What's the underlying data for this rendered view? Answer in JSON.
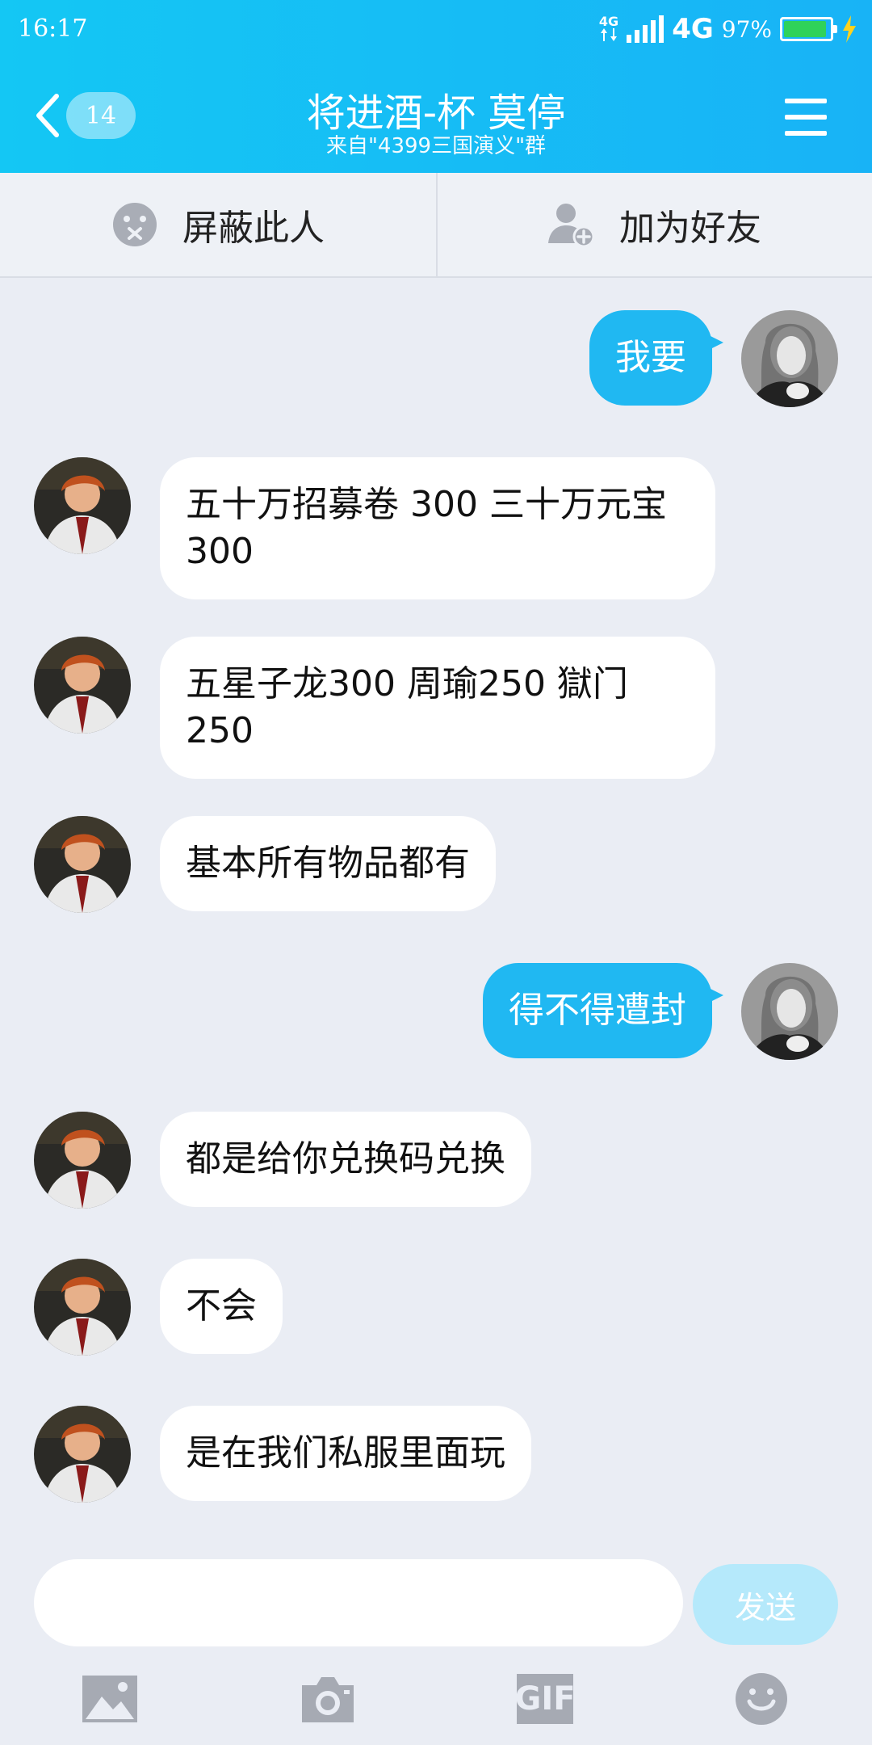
{
  "status": {
    "time": "16:17",
    "net_small": "4G",
    "net_big": "4G",
    "battery": "97%",
    "battery_level": 0.97
  },
  "header": {
    "badge": "14",
    "title": "将进酒-杯 莫停",
    "subtitle": "来自\"4399三国演义\"群"
  },
  "actions": {
    "block": "屏蔽此人",
    "add_friend": "加为好友"
  },
  "messages": [
    {
      "side": "out",
      "text": "我要"
    },
    {
      "side": "in",
      "text": "五十万招募卷 300 三十万元宝 300"
    },
    {
      "side": "in",
      "text": "五星子龙300  周瑜250 獄门 250"
    },
    {
      "side": "in",
      "text": "基本所有物品都有"
    },
    {
      "side": "out",
      "text": "得不得遭封"
    },
    {
      "side": "in",
      "text": "都是给你兑换码兑换"
    },
    {
      "side": "in",
      "text": "不会"
    },
    {
      "side": "in",
      "text": "是在我们私服里面玩"
    }
  ],
  "input": {
    "placeholder": "",
    "send_label": "发送"
  },
  "toolbar": {
    "gif_label": "GIF"
  },
  "colors": {
    "header": "#18b3f6",
    "bubble_out": "#20b8f2",
    "background": "#eaedf4"
  }
}
